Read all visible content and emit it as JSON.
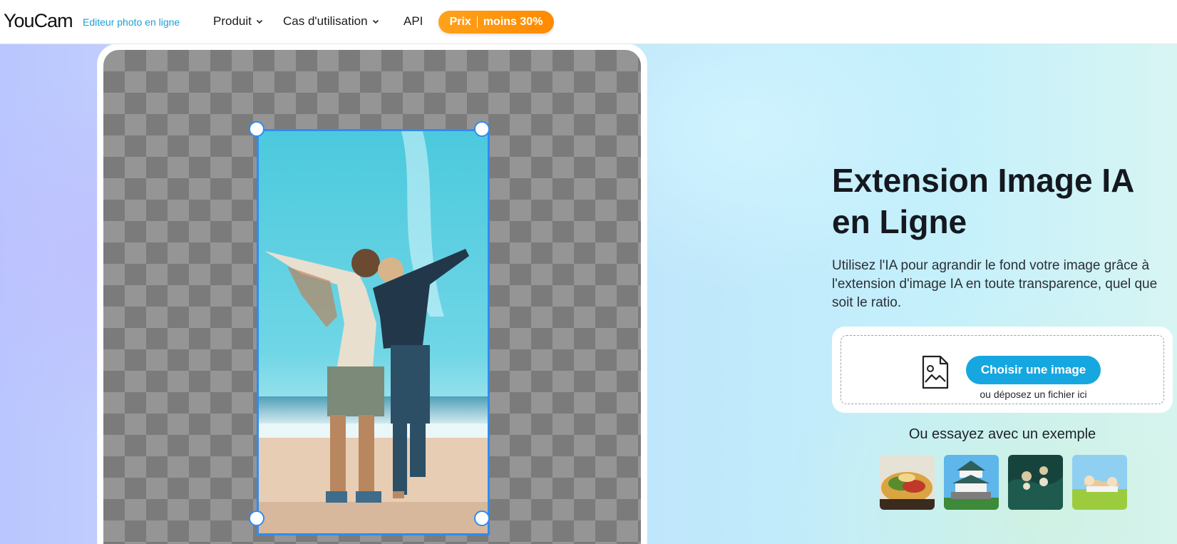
{
  "header": {
    "logo": "YouCam",
    "logo_subtitle": "Editeur photo en ligne",
    "nav": {
      "produit": "Produit",
      "cas": "Cas d'utilisation",
      "api": "API"
    },
    "promo": {
      "prix": "Prix",
      "discount": "moins 30%"
    }
  },
  "hero": {
    "title": "Extension Image IA en Ligne",
    "description": "Utilisez l'IA pour agrandir le fond votre image grâce à l'extension d'image IA en toute transparence, quel que soit le ratio.",
    "upload": {
      "button": "Choisir une image",
      "hint": "ou déposez un fichier ici"
    },
    "examples_label": "Ou essayez avec un exemple"
  },
  "colors": {
    "accent": "#16a7e0",
    "promo": "#ff9a10",
    "selection": "#2f8cf0",
    "brand_sub": "#1c9fd6"
  },
  "icons": [
    "chevron-down-icon",
    "image-file-icon"
  ]
}
